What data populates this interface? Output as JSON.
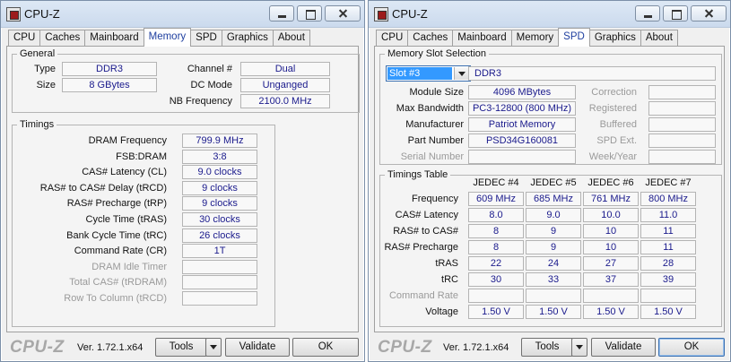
{
  "app": {
    "title": "CPU-Z",
    "brand": "CPU-Z",
    "version": "Ver. 1.72.1.x64",
    "tools_label": "Tools",
    "validate_label": "Validate",
    "ok_label": "OK"
  },
  "tabs": [
    "CPU",
    "Caches",
    "Mainboard",
    "Memory",
    "SPD",
    "Graphics",
    "About"
  ],
  "memory": {
    "general_title": "General",
    "type_label": "Type",
    "type_value": "DDR3",
    "size_label": "Size",
    "size_value": "8 GBytes",
    "channel_label": "Channel #",
    "channel_value": "Dual",
    "dcmode_label": "DC Mode",
    "dcmode_value": "Unganged",
    "nbfreq_label": "NB Frequency",
    "nbfreq_value": "2100.0 MHz",
    "timings_title": "Timings",
    "timings": [
      {
        "label": "DRAM Frequency",
        "value": "799.9 MHz"
      },
      {
        "label": "FSB:DRAM",
        "value": "3:8"
      },
      {
        "label": "CAS# Latency (CL)",
        "value": "9.0 clocks"
      },
      {
        "label": "RAS# to CAS# Delay (tRCD)",
        "value": "9 clocks"
      },
      {
        "label": "RAS# Precharge (tRP)",
        "value": "9 clocks"
      },
      {
        "label": "Cycle Time (tRAS)",
        "value": "30 clocks"
      },
      {
        "label": "Bank Cycle Time (tRC)",
        "value": "26 clocks"
      },
      {
        "label": "Command Rate (CR)",
        "value": "1T"
      },
      {
        "label": "DRAM Idle Timer",
        "value": ""
      },
      {
        "label": "Total CAS# (tRDRAM)",
        "value": ""
      },
      {
        "label": "Row To Column (tRCD)",
        "value": ""
      }
    ]
  },
  "spd": {
    "slot_title": "Memory Slot Selection",
    "slot_selected": "Slot #3",
    "slot_type": "DDR3",
    "module_size_label": "Module Size",
    "module_size_value": "4096 MBytes",
    "max_bw_label": "Max Bandwidth",
    "max_bw_value": "PC3-12800 (800 MHz)",
    "manufacturer_label": "Manufacturer",
    "manufacturer_value": "Patriot Memory",
    "part_label": "Part Number",
    "part_value": "PSD34G160081",
    "serial_label": "Serial Number",
    "serial_value": "",
    "correction_label": "Correction",
    "registered_label": "Registered",
    "buffered_label": "Buffered",
    "spdext_label": "SPD Ext.",
    "weekyear_label": "Week/Year",
    "timings_title": "Timings Table",
    "columns": [
      "JEDEC #4",
      "JEDEC #5",
      "JEDEC #6",
      "JEDEC #7"
    ],
    "rows": [
      {
        "label": "Frequency",
        "values": [
          "609 MHz",
          "685 MHz",
          "761 MHz",
          "800 MHz"
        ]
      },
      {
        "label": "CAS# Latency",
        "values": [
          "8.0",
          "9.0",
          "10.0",
          "11.0"
        ]
      },
      {
        "label": "RAS# to CAS#",
        "values": [
          "8",
          "9",
          "10",
          "11"
        ]
      },
      {
        "label": "RAS# Precharge",
        "values": [
          "8",
          "9",
          "10",
          "11"
        ]
      },
      {
        "label": "tRAS",
        "values": [
          "22",
          "24",
          "27",
          "28"
        ]
      },
      {
        "label": "tRC",
        "values": [
          "30",
          "33",
          "37",
          "39"
        ]
      },
      {
        "label": "Command Rate",
        "values": [
          "",
          "",
          "",
          ""
        ]
      },
      {
        "label": "Voltage",
        "values": [
          "1.50 V",
          "1.50 V",
          "1.50 V",
          "1.50 V"
        ]
      }
    ]
  }
}
